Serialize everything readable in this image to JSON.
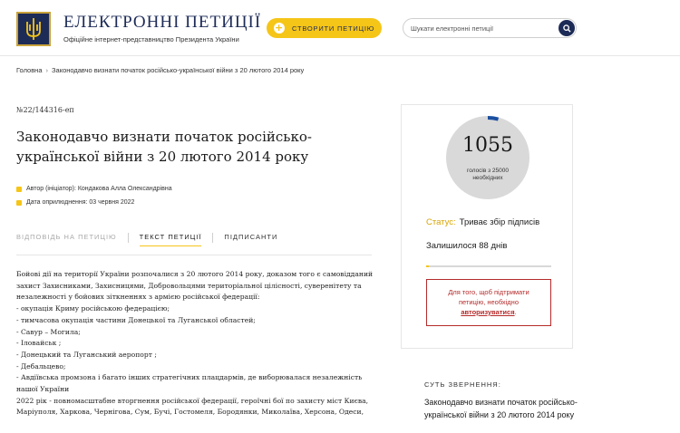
{
  "header": {
    "title": "ЕЛЕКТРОННІ ПЕТИЦІЇ",
    "subtitle": "Офіційне інтернет-представництво Президента України",
    "create_label": "СТВОРИТИ ПЕТИЦІЮ",
    "search_placeholder": "Шукати електронні петиції",
    "icons": {
      "logo": "trident-emblem-icon",
      "create": "plus-icon",
      "search": "search-icon"
    }
  },
  "breadcrumb": {
    "home": "Головна",
    "separator": "›",
    "current": "Законодавчо визнати початок російсько-української війни з 20 лютого 2014 року"
  },
  "petition": {
    "number": "№22/144316-еп",
    "title": "Законодавчо визнати початок російсько-української війни з 20 лютого 2014 року",
    "author": "Автор (ініціатор): Кондакова Алла Олександрівна",
    "date": "Дата оприлюднення: 03 червня 2022"
  },
  "tabs": [
    {
      "label": "ВІДПОВІДЬ НА ПЕТИЦІЮ",
      "state": "disabled"
    },
    {
      "label": "ТЕКСТ ПЕТИЦІЇ",
      "state": "active"
    },
    {
      "label": "ПІДПИСАНТИ",
      "state": "normal"
    }
  ],
  "body_lines": [
    "Бойові дії на території України розпочалися з 20 лютого 2014 року, доказом того є самовідданий захист Захисниками, Захисницями, Добровольцями територіальної цілісності, суверенітету та незалежності у бойових зіткненнях з армією російської федерації:",
    "- окупація Криму російською федерацією;",
    "- тимчасова окупація частини Донецької та Луганської областей;",
    "- Савур – Могила;",
    "- Іловайськ ;",
    "- Донецький та Луганський аеропорт ;",
    "- Дебальцево;",
    "- Авдіївська промзона і багато інших стратегічних плацдармів, де виборювалася незалежність нашої України",
    "2022 рік - повномасштабне вторгнення російської федерації, героїчні бої по захисту міст Києва, Маріуполя, Харкова, Чернігова, Сум, Бучі, Гостомеля, Бородянки, Миколаїва, Херсона, Одеси,"
  ],
  "stats": {
    "count": "1055",
    "count_label_1": "голосів з 25000",
    "count_label_2": "необхідних",
    "progress_fraction": 0.0422,
    "status_label": "Статус:",
    "status_value": "Триває збір підписів",
    "remaining": "Залишилося 88 днів",
    "days_fraction": 0.02,
    "auth_text_1": "Для того, щоб підтримати",
    "auth_text_2": "петицію, необхідно",
    "auth_link": "авторизуватися",
    "auth_end": "."
  },
  "summary": {
    "label": "СУТЬ ЗВЕРНЕННЯ:",
    "text": "Законодавчо визнати початок російсько-української війни з 20 лютого 2014 року"
  },
  "colors": {
    "navy": "#1d2b57",
    "accent": "#f5c518",
    "alert": "#b52b2b",
    "circle": "#d9d9d9"
  }
}
